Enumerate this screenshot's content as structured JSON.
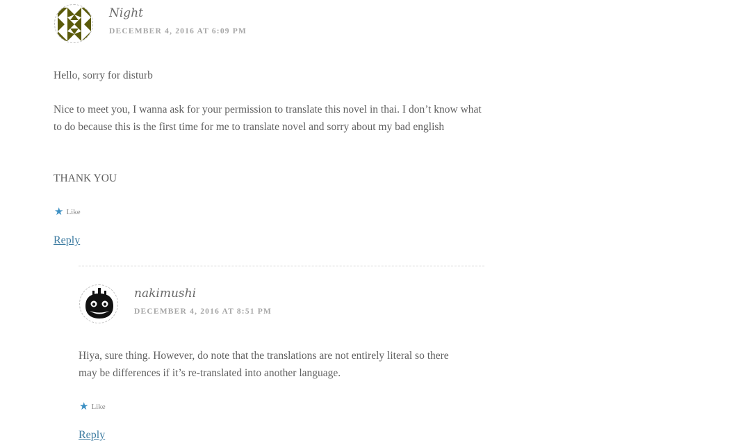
{
  "comments": [
    {
      "author": "Night",
      "date": "DECEMBER 4, 2016 AT 6:09 PM",
      "paragraphs": [
        "Hello, sorry for disturb",
        "Nice to meet you, I wanna ask for your permission to translate this novel in thai. I don’t know what to do because this is the first time for me to translate novel and sorry about my bad english",
        "THANK YOU"
      ],
      "like_label": "Like",
      "reply_label": "Reply",
      "avatar_icon": "geometric-identicon"
    },
    {
      "author": "nakimushi",
      "date": "DECEMBER 4, 2016 AT 8:51 PM",
      "paragraphs": [
        "Hiya, sure thing. However, do note that the translations are not entirely literal so there may be differences if it’s re-translated into another language."
      ],
      "like_label": "Like",
      "reply_label": "Reply",
      "avatar_icon": "black-creature-avatar"
    }
  ],
  "colors": {
    "accent_star": "#3b8fc3",
    "link": "#3b7aa0",
    "identicon": "#5a5a0a"
  }
}
